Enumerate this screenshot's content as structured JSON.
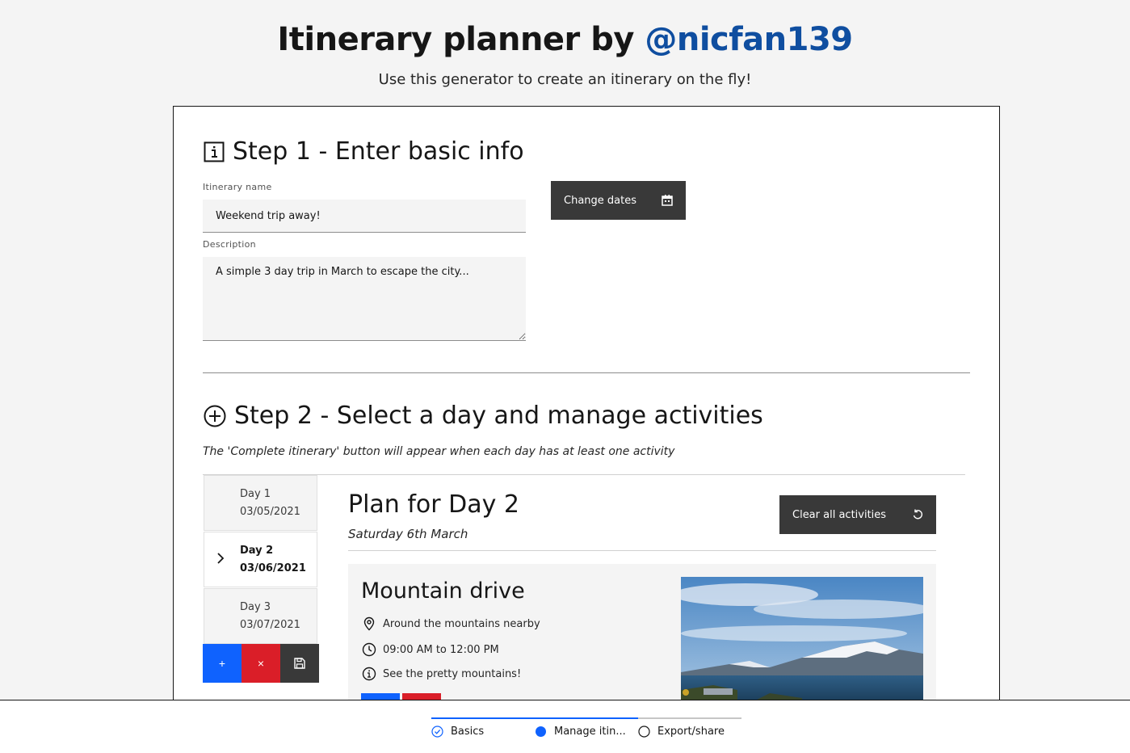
{
  "header": {
    "title_prefix": "Itinerary planner by ",
    "title_handle": "@nicfan139",
    "subtitle": "Use this generator to create an itinerary on the fly!"
  },
  "step1": {
    "heading": "Step 1 - Enter basic info",
    "name_label": "Itinerary name",
    "name_value": "Weekend trip away!",
    "description_label": "Description",
    "description_value": "A simple 3 day trip in March to escape the city...",
    "change_dates_label": "Change dates"
  },
  "step2": {
    "heading": "Step 2 - Select a day and manage activities",
    "hint": "The 'Complete itinerary' button will appear when each day has at least one activity",
    "days": [
      {
        "label": "Day 1",
        "date": "03/05/2021"
      },
      {
        "label": "Day 2",
        "date": "03/06/2021"
      },
      {
        "label": "Day 3",
        "date": "03/07/2021"
      }
    ],
    "add_symbol": "+",
    "remove_symbol": "×",
    "plan": {
      "title": "Plan for Day 2",
      "date": "Saturday 6th March",
      "clear_label": "Clear all activities"
    },
    "activity": {
      "title": "Mountain drive",
      "location": "Around the mountains nearby",
      "time": "09:00 AM to 12:00 PM",
      "notes": "See the pretty mountains!"
    }
  },
  "progress": {
    "steps": [
      {
        "label": "Basics",
        "state": "complete"
      },
      {
        "label": "Manage itin...",
        "state": "current"
      },
      {
        "label": "Export/share",
        "state": "incomplete"
      }
    ]
  },
  "colors": {
    "accent": "#0f62fe",
    "danger": "#da1e28",
    "dark": "#393939",
    "link": "#0f4ea0"
  }
}
